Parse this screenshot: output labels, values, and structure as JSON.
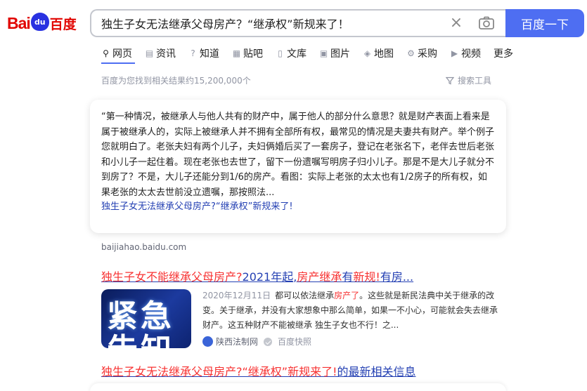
{
  "header": {
    "logo_bai": "Bai",
    "logo_paw": "du",
    "logo_cn": "百度",
    "search_value": "独生子女无法继承父母房产？“继承权”新规来了！",
    "search_button": "百度一下"
  },
  "tabs": [
    {
      "label": "网页",
      "icon": "search-icon"
    },
    {
      "label": "资讯",
      "icon": "news-icon"
    },
    {
      "label": "知道",
      "icon": "question-icon"
    },
    {
      "label": "贴吧",
      "icon": "tieba-icon"
    },
    {
      "label": "文库",
      "icon": "document-icon"
    },
    {
      "label": "图片",
      "icon": "image-icon"
    },
    {
      "label": "地图",
      "icon": "map-pin-icon"
    },
    {
      "label": "采购",
      "icon": "cart-icon"
    },
    {
      "label": "视频",
      "icon": "video-icon"
    },
    {
      "label": "更多",
      "icon": ""
    }
  ],
  "result_count": "百度为您找到相关结果约15,200,000个",
  "search_tools": "搜索工具",
  "card": {
    "text": "“第一种情况，被继承人与他人共有的财产中，属于他人的部分什么意思？就是财产表面上看来是属于被继承人的，实际上被继承人并不拥有全部所有权，最常见的情况是夫妻共有财产。举个例子您就明白了。老张夫妇有两个儿子，夫妇俩婚后买了一套房子，登记在老张名下，老伴去世后老张和小儿子一起住着。现在老张也去世了，留下一份遗嘱写明房子归小儿子。那是不是大儿子就分不到房了？不是，大儿子还能分到1/6的房产。看图：实际上老张的太太也有1/2房子的所有权，如果老张的太太去世前没立遗嘱，那按照法...",
    "link": "独生子女无法继承父母房产?“继承权”新规来了!",
    "source": "baijiahao.baidu.com"
  },
  "result2": {
    "title_parts": [
      {
        "t": "独生子女不能继承父母房产",
        "hl": true
      },
      {
        "t": "?",
        "hl": true
      },
      {
        "t": "2021年起",
        "hl": false
      },
      {
        "t": ",",
        "hl": false
      },
      {
        "t": "房产继承",
        "hl": true
      },
      {
        "t": "有",
        "hl": false
      },
      {
        "t": "新规",
        "hl": true
      },
      {
        "t": "!",
        "hl": true
      },
      {
        "t": "有房...",
        "hl": false
      }
    ],
    "thumb_line1": "紧急",
    "thumb_line2": "告知",
    "date": "2020年12月11日",
    "body_a": "都可以依法继承",
    "body_hl": "房产了",
    "body_b": "。这些就是新民法典中关于继承的改变。关于继承，并没有大家想象中那么简单，如果一不小心，可能就会失去继承财产。这五种财产不能被继承 独生子女也不行！之...",
    "site": "陕西法制网",
    "snapshot": "百度快照"
  },
  "result3": {
    "title_hl": "独生子女无法继承父母房产?“继承权”新规来了!",
    "title_rest": "的最新相关信息"
  },
  "colors": {
    "brand_blue": "#4e6ef2",
    "link_blue": "#2440b3",
    "highlight_red": "#f73131",
    "logo_red": "#e10602"
  }
}
